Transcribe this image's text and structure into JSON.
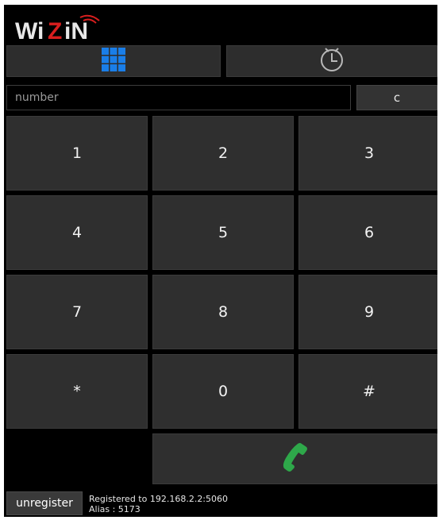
{
  "app": {
    "logo_text": "WiZiN",
    "brand_colors": {
      "logo_text": "#e8e8e8",
      "logo_accent": "#d81e1e",
      "tab_active": "#1a7ee8",
      "call_icon": "#2ea84a"
    }
  },
  "tabs": [
    {
      "name": "dialpad",
      "icon": "dialpad-grid-icon",
      "active": true
    },
    {
      "name": "history",
      "icon": "clock-history-icon",
      "active": false
    }
  ],
  "dialer": {
    "number_value": "",
    "number_placeholder": "number",
    "clear_label": "c"
  },
  "keypad": {
    "keys": [
      "1",
      "2",
      "3",
      "4",
      "5",
      "6",
      "7",
      "8",
      "9",
      "*",
      "0",
      "#"
    ]
  },
  "call_button": {
    "icon": "phone-call-icon"
  },
  "footer": {
    "unregister_label": "unregister",
    "registered_text": "Registered to 192.168.2.2:5060",
    "alias_text": "Alias : 5173"
  }
}
